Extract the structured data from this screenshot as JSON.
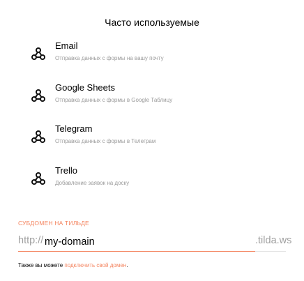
{
  "section": {
    "title": "Часто используемые"
  },
  "services": [
    {
      "name": "Email",
      "description": "Отправка данных с формы на вашу почту",
      "icon": "webhook-icon"
    },
    {
      "name": "Google Sheets",
      "description": "Отправка данных с формы в Google Таблицу",
      "icon": "webhook-icon"
    },
    {
      "name": "Telegram",
      "description": "Отправка данных с формы в Телеграм",
      "icon": "webhook-icon"
    },
    {
      "name": "Trello",
      "description": "Добавление заявок на доску",
      "icon": "webhook-icon"
    }
  ],
  "subdomain": {
    "label": "СУБДОМЕН НА ТИЛЬДЕ",
    "prefix": "http://",
    "value": "my-domain",
    "suffix": ".tilda.ws"
  },
  "note": {
    "text": "Также вы можете ",
    "link": "подключить свой домен",
    "end": "."
  },
  "colors": {
    "accent": "#f4845f",
    "muted": "#9a9a9a"
  }
}
